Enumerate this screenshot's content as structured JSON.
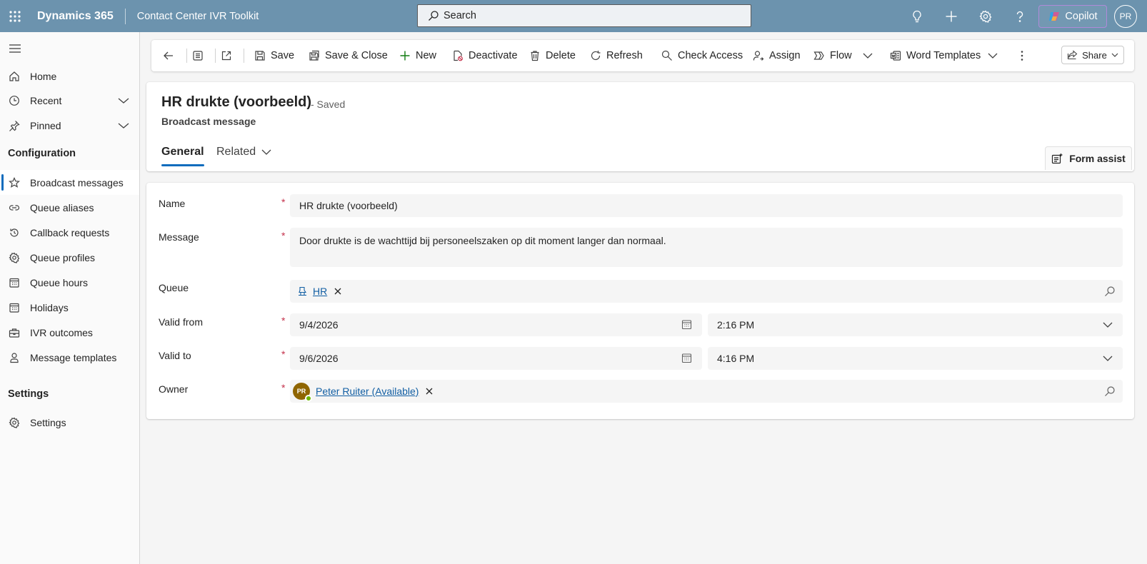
{
  "topbar": {
    "brand": "Dynamics 365",
    "app_name": "Contact Center IVR Toolkit",
    "search_placeholder": "Search",
    "copilot_label": "Copilot",
    "user_initials": "PR",
    "icons": [
      "waffle-icon",
      "search-icon",
      "lightbulb-icon",
      "plus-icon",
      "gear-icon",
      "help-icon",
      "copilot-icon"
    ]
  },
  "sidebar": {
    "top_items": [
      {
        "label": "Home",
        "icon": "home-icon"
      },
      {
        "label": "Recent",
        "icon": "clock-icon",
        "expandable": true
      },
      {
        "label": "Pinned",
        "icon": "pin-icon",
        "expandable": true
      }
    ],
    "configuration_header": "Configuration",
    "config_items": [
      {
        "label": "Broadcast messages",
        "icon": "star-icon",
        "selected": true
      },
      {
        "label": "Queue aliases",
        "icon": "link-icon"
      },
      {
        "label": "Callback requests",
        "icon": "callback-icon"
      },
      {
        "label": "Queue profiles",
        "icon": "gear-icon"
      },
      {
        "label": "Queue hours",
        "icon": "calendar-icon"
      },
      {
        "label": "Holidays",
        "icon": "calendar-icon"
      },
      {
        "label": "IVR outcomes",
        "icon": "briefcase-icon"
      },
      {
        "label": "Message templates",
        "icon": "person-icon"
      }
    ],
    "settings_header": "Settings",
    "settings_items": [
      {
        "label": "Settings",
        "icon": "gear-icon"
      }
    ]
  },
  "commandbar": {
    "save": "Save",
    "save_close": "Save & Close",
    "new": "New",
    "deactivate": "Deactivate",
    "delete": "Delete",
    "refresh": "Refresh",
    "check_access": "Check Access",
    "assign": "Assign",
    "flow": "Flow",
    "word_templates": "Word Templates",
    "share": "Share"
  },
  "record": {
    "title": "HR drukte (voorbeeld)",
    "status": "- Saved",
    "entity": "Broadcast message",
    "tabs": [
      {
        "label": "General",
        "active": true
      },
      {
        "label": "Related",
        "active": false
      }
    ],
    "form_assist": "Form assist"
  },
  "form": {
    "name_label": "Name",
    "name_value": "HR drukte (voorbeeld)",
    "message_label": "Message",
    "message_value": "Door drukte is de wachttijd bij personeelszaken op dit moment langer dan normaal.",
    "queue_label": "Queue",
    "queue_value": "HR",
    "valid_from_label": "Valid from",
    "valid_from_date": "9/4/2026",
    "valid_from_time": "2:16 PM",
    "valid_to_label": "Valid to",
    "valid_to_date": "9/6/2026",
    "valid_to_time": "4:16 PM",
    "owner_label": "Owner",
    "owner_initials": "PR",
    "owner_value": "Peter Ruiter (Available)",
    "required_mark": "*"
  },
  "colors": {
    "topbar": "#6c93ae",
    "accent": "#0f6cbd",
    "required": "#c4314b",
    "link": "#115ea3",
    "owner_avatar": "#8f6500",
    "presence_available": "#6bb700"
  }
}
